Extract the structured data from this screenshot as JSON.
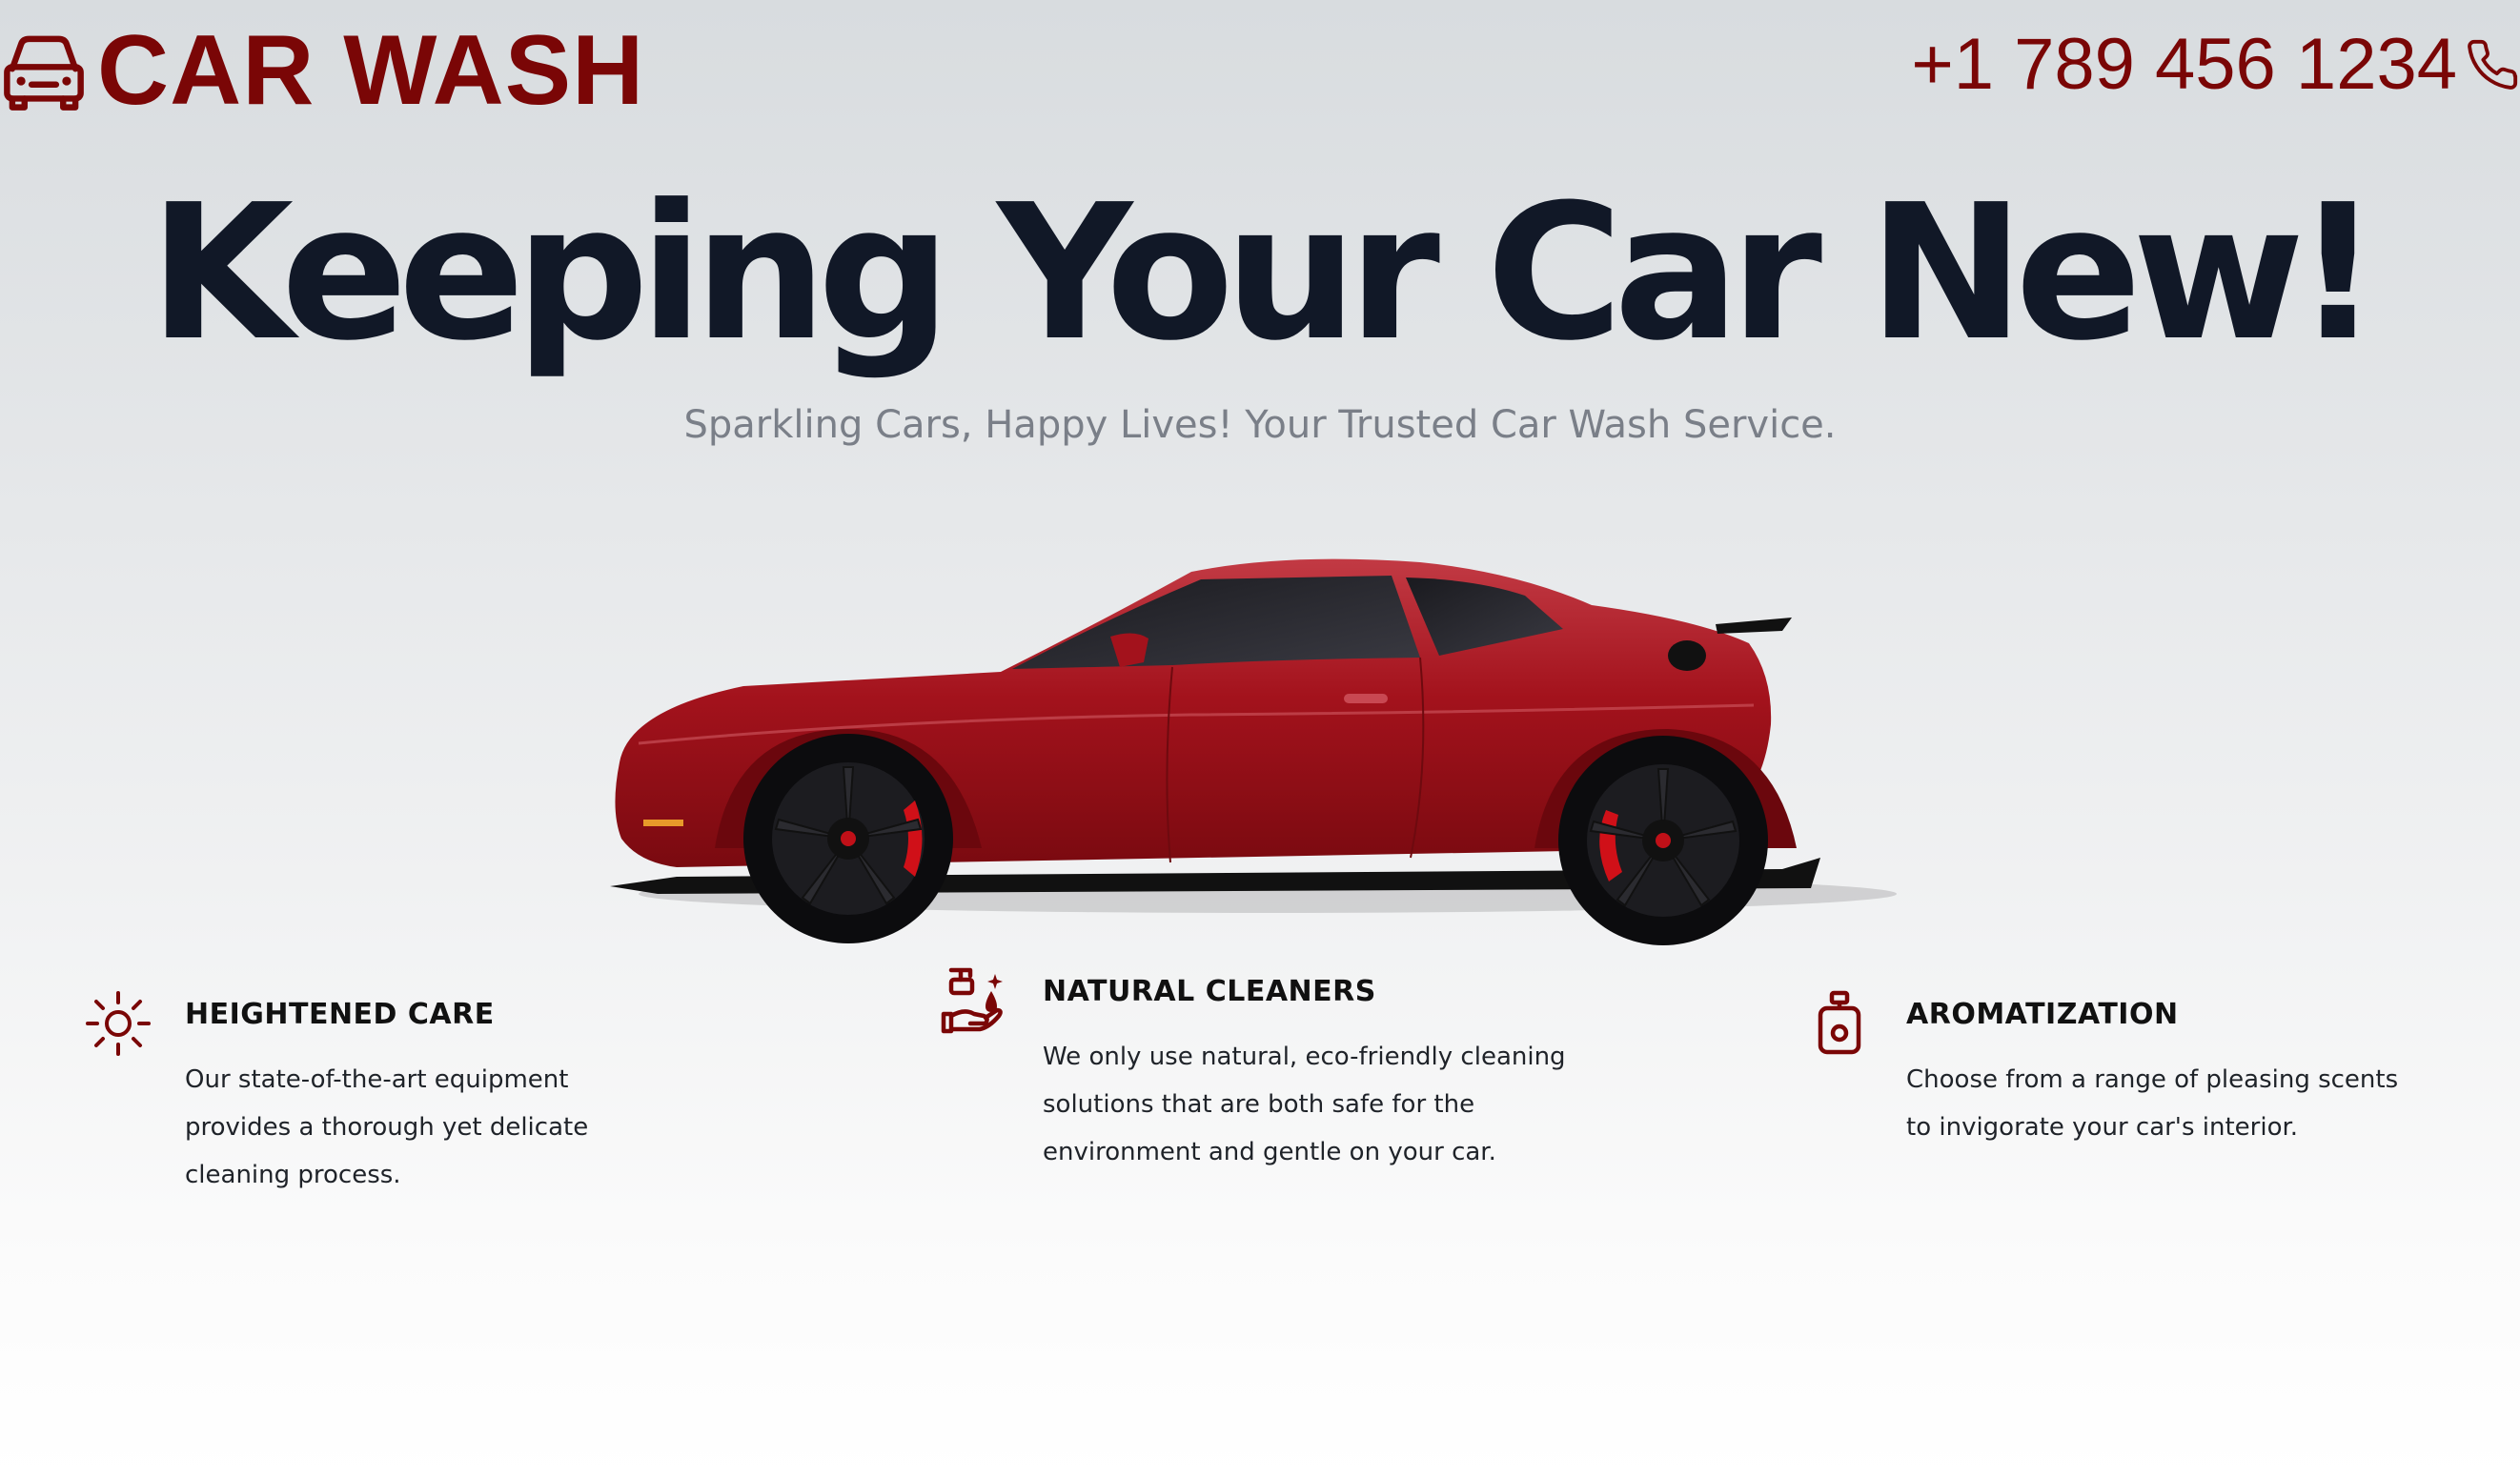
{
  "header": {
    "brand": "CAR WASH",
    "phone": "+1 789 456 1234"
  },
  "hero": {
    "title": "Keeping Your Car New!",
    "subtitle": "Sparkling Cars, Happy Lives! Your Trusted Car Wash Service."
  },
  "features": [
    {
      "icon": "sun-icon",
      "title": "HEIGHTENED CARE",
      "description": "Our state-of-the-art equipment provides a thorough yet delicate cleaning process."
    },
    {
      "icon": "hand-soap-icon",
      "title": "NATURAL CLEANERS",
      "description": "We only use natural, eco-friendly cleaning solutions that are both safe for the environment and gentle on your car."
    },
    {
      "icon": "perfume-bottle-icon",
      "title": "AROMATIZATION",
      "description": "Choose from a range of pleasing scents to invigorate your car's interior."
    }
  ],
  "colors": {
    "brand": "#7a0606",
    "heading": "#111827",
    "subtitle": "#7a7f88",
    "car_body": "#a3121c"
  }
}
